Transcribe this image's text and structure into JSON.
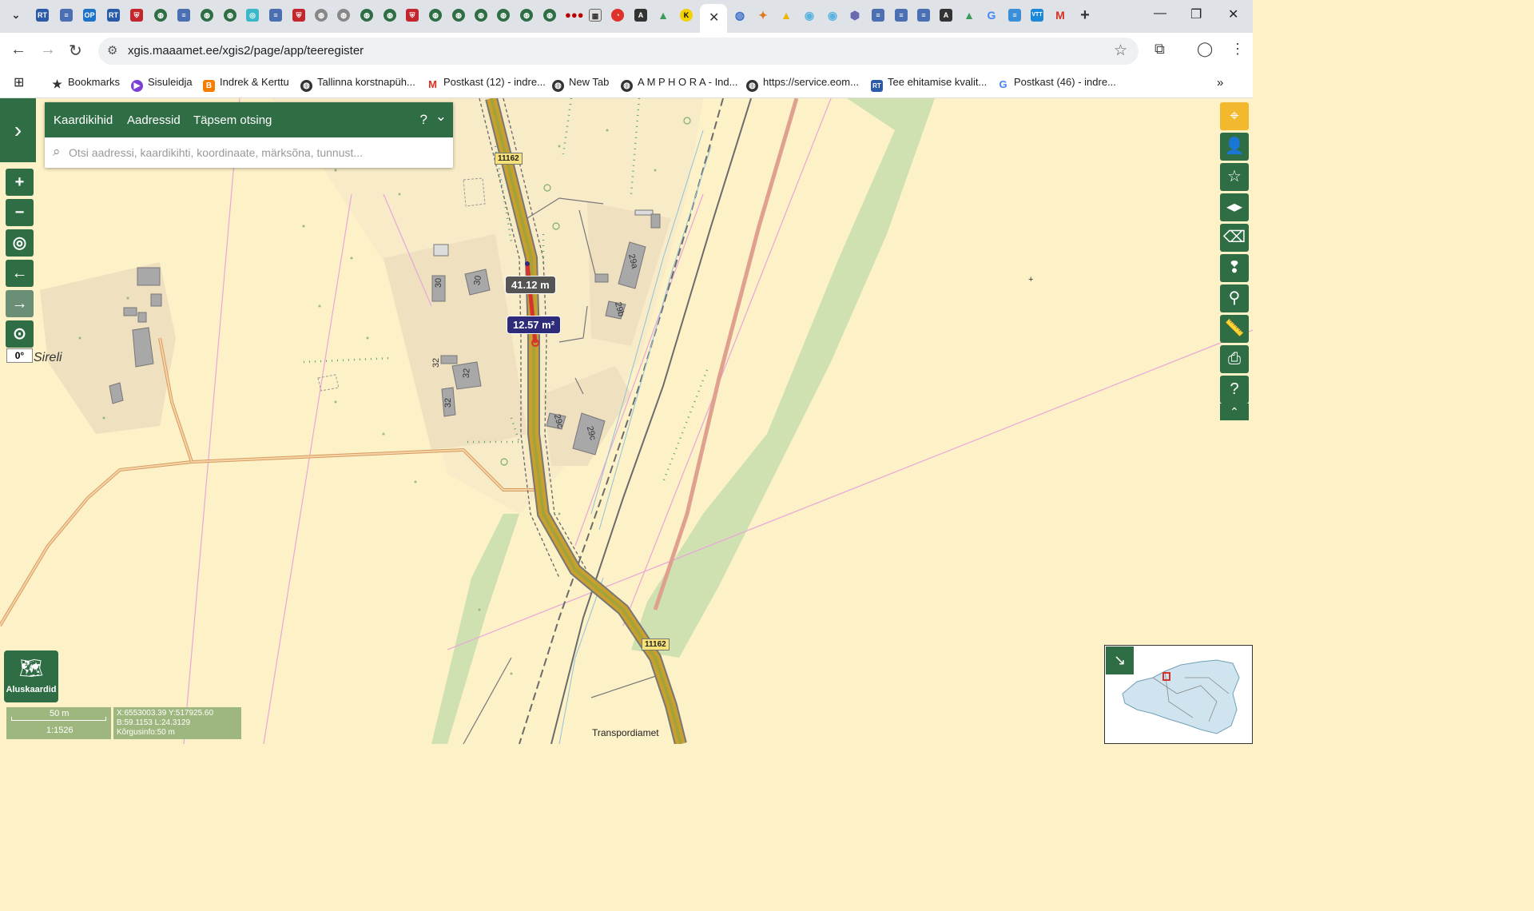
{
  "browser": {
    "url": "xgis.maaamet.ee/xgis2/page/app/teeregister",
    "bookmarks": [
      {
        "label": "Bookmarks",
        "icon": "star-icon"
      },
      {
        "label": "Sisuleidja",
        "icon": "sisuleidja-icon"
      },
      {
        "label": "Indrek & Kerttu",
        "icon": "blogger-icon"
      },
      {
        "label": "Tallinna korstnapüh...",
        "icon": "web-icon"
      },
      {
        "label": "Postkast (12) - indre...",
        "icon": "gmail-icon"
      },
      {
        "label": "New Tab",
        "icon": "web-icon"
      },
      {
        "label": "A M P H O R A - Ind...",
        "icon": "web-icon"
      },
      {
        "label": "https://service.eom...",
        "icon": "web-icon"
      },
      {
        "label": "Tee ehitamise kvalit...",
        "icon": "rt-icon"
      },
      {
        "label": "Postkast (46) - indre...",
        "icon": "google-icon"
      }
    ]
  },
  "search": {
    "tabs": [
      "Kaardikihid",
      "Aadressid",
      "Täpsem otsing"
    ],
    "help": "?",
    "placeholder": "Otsi aadressi, kaardikihti, koordinaate, märksõna, tunnust..."
  },
  "map_controls": {
    "rotation": "0°",
    "basemap_label": "Aluskaardid"
  },
  "map_labels": {
    "place_sireli": "Sireli",
    "road_number_top": "11162",
    "road_number_bottom": "11162",
    "distance": "41.12 m",
    "area": "12.57 m²",
    "attribution": "Transpordiamet",
    "house_numbers": [
      "30",
      "30",
      "32",
      "32",
      "32",
      "29a",
      "29b",
      "29c",
      "29c"
    ]
  },
  "status": {
    "scale_distance": "50 m",
    "scale_ratio": "1:1526",
    "coords_xy": "X:6553003.39 Y:517925.60",
    "coords_bl": "B:59.1153 L:24.3129",
    "elevation": "Kõrgusinfo:50 m"
  },
  "colors": {
    "accent_green": "#2f6d45",
    "active_tool": "#f2b92e",
    "measure_dark": "#555555",
    "measure_blue": "#2e2c7a"
  }
}
